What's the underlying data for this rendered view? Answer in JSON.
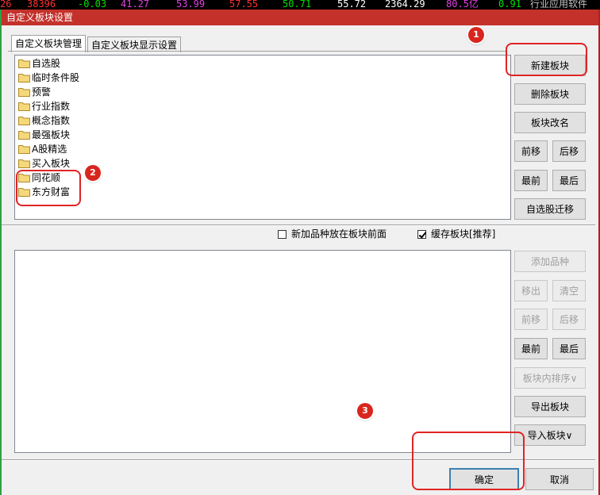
{
  "ticker": [
    "26",
    "38396",
    "-0.03",
    "41.27",
    "53.99",
    "57.55",
    "50.71",
    "55.72",
    "2364.29",
    "80.5亿",
    "0.91",
    "行业应用软件"
  ],
  "ticker_colors": [
    "#ff3030",
    "#ff3030",
    "#00e000",
    "#e040e0",
    "#e040e0",
    "#ff3030",
    "#00e000",
    "#ffffff",
    "#ffffff",
    "#e040e0",
    "#00e000",
    "#c0c0c0"
  ],
  "window": {
    "title": "自定义板块设置"
  },
  "tabs": [
    {
      "label": "自定义板块管理",
      "active": true
    },
    {
      "label": "自定义板块显示设置",
      "active": false
    }
  ],
  "blocks": [
    "自选股",
    "临时条件股",
    "预警",
    "行业指数",
    "概念指数",
    "最强板块",
    "A股精选",
    "买入板块",
    "同花顺",
    "东方财富"
  ],
  "block_buttons": {
    "new": "新建板块",
    "delete": "删除板块",
    "rename": "板块改名",
    "move_up": "前移",
    "move_down": "后移",
    "first": "最前",
    "last": "最后",
    "migrate": "自选股迁移"
  },
  "options": {
    "add_front": {
      "label": "新加品种放在板块前面",
      "checked": false
    },
    "cache": {
      "label": "缓存板块[推荐]",
      "checked": true
    }
  },
  "stock_buttons": {
    "add": "添加品种",
    "remove": "移出",
    "clear": "清空",
    "move_up": "前移",
    "move_down": "后移",
    "first": "最前",
    "last": "最后",
    "sort": "板块内排序∨",
    "export": "导出板块",
    "import": "导入板块∨"
  },
  "dialog_buttons": {
    "ok": "确定",
    "cancel": "取消"
  },
  "annotations": [
    "1",
    "2",
    "3"
  ],
  "colors": {
    "titlebar": "#c4312b",
    "annotation": "#e02424",
    "folder": "#f5d879"
  }
}
